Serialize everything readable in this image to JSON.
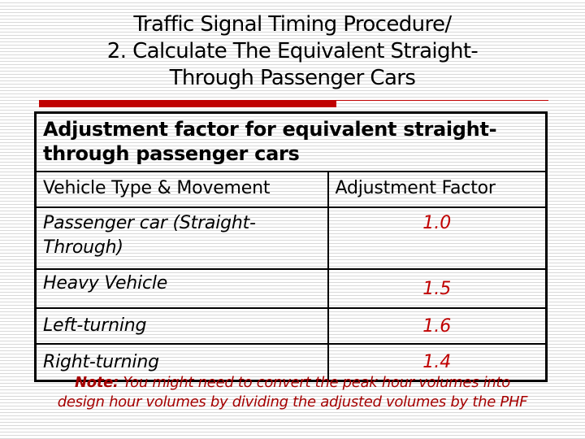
{
  "slide": {
    "title_lines": [
      "Traffic Signal Timing Procedure/",
      "2. Calculate The Equivalent Straight-",
      "Through Passenger Cars"
    ],
    "accent_color": "#c00000"
  },
  "table": {
    "caption": "Adjustment factor for equivalent straight-through passenger cars",
    "caption_lines": [
      "Adjustment factor for equivalent straight-",
      "through passenger cars"
    ],
    "columns": [
      "Vehicle Type & Movement",
      "Adjustment Factor"
    ],
    "rows": [
      {
        "label_lines": [
          "Passenger car (Straight-",
          "Through)"
        ],
        "label": "Passenger car (Straight-Through)",
        "value": "1.0"
      },
      {
        "label_lines": [
          "Heavy Vehicle"
        ],
        "label": "Heavy Vehicle",
        "value": "1.5"
      },
      {
        "label_lines": [
          "Left-turning"
        ],
        "label": "Left-turning",
        "value": "1.6"
      },
      {
        "label_lines": [
          "Right-turning"
        ],
        "label": "Right-turning",
        "value": "1.4"
      }
    ],
    "value_color": "#c00000"
  },
  "note": {
    "label": "Note:",
    "line1_rest": " You might need to convert the peak hour volumes into",
    "line2": "design hour volumes by dividing the adjusted volumes by the PHF",
    "color": "#a50000"
  }
}
